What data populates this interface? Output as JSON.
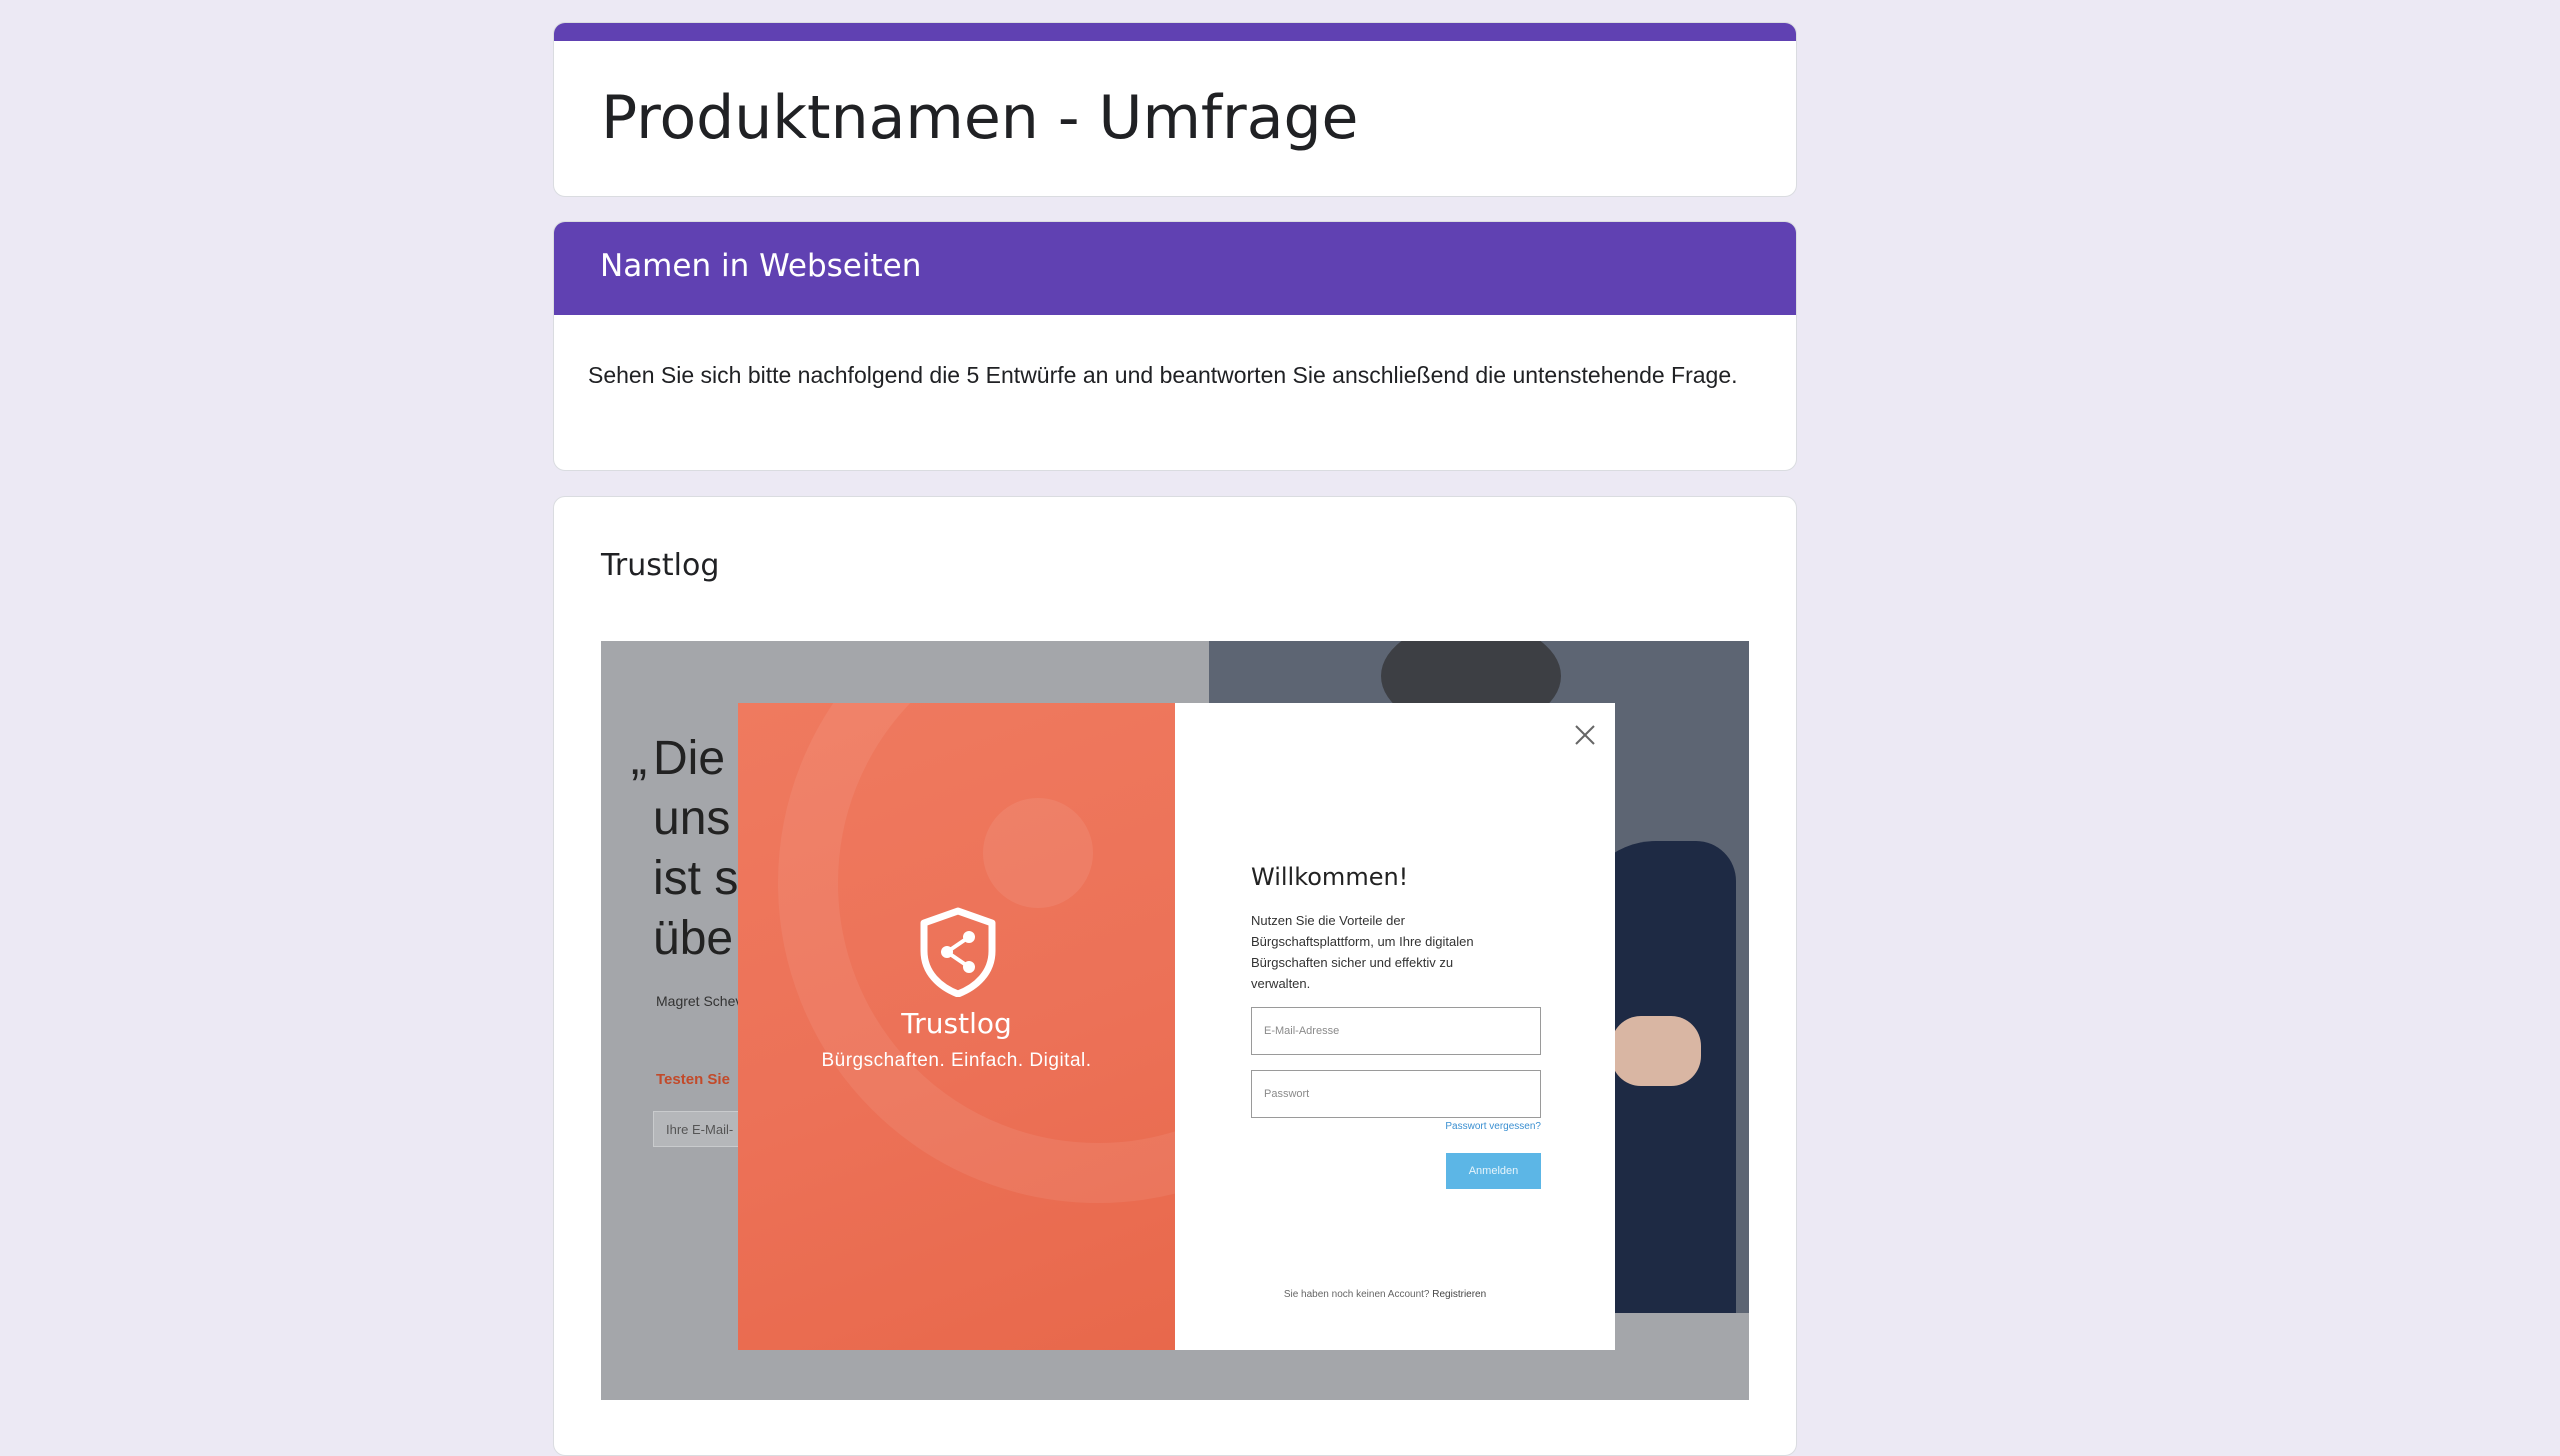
{
  "form": {
    "title": "Produktnamen - Umfrage",
    "accent_color": "#6041b2",
    "background_color": "#ece9f4"
  },
  "section": {
    "header": "Namen in Webseiten",
    "description": "Sehen Sie sich bitte nachfolgend die 5 Entwürfe an und beantworten Sie anschließend die untenstehende Frage."
  },
  "question": {
    "title": "Trustlog"
  },
  "screenshot": {
    "background_page": {
      "quote_mark": "„",
      "quote_lines": "Die\nuns\nist s\nübe",
      "author": "Magret Schev",
      "cta": "Testen Sie",
      "email_placeholder": "Ihre E-Mail-"
    },
    "modal": {
      "brand_name": "Trustlog",
      "slogan": "Bürgschaften. Einfach. Digital.",
      "welcome": "Willkommen!",
      "intro": "Nutzen Sie die Vorteile der Bürgschaftsplattform, um Ihre digitalen Bürgschaften sicher und effektiv zu verwalten.",
      "email_placeholder": "E-Mail-Adresse",
      "password_placeholder": "Passwort",
      "forgot_password": "Passwort vergessen?",
      "login_button": "Anmelden",
      "no_account_text": "Sie haben noch keinen Account?",
      "register_link": "Registrieren",
      "brand_color": "#ec7157",
      "button_color": "#5cb6e6",
      "icons": {
        "logo": "shield-share-icon",
        "close": "close-icon"
      }
    }
  }
}
